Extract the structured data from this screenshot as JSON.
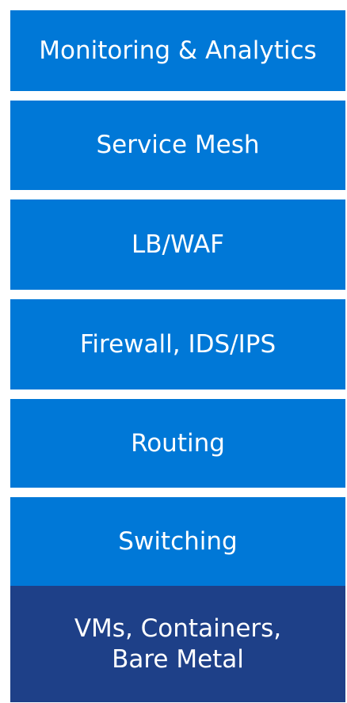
{
  "layers": [
    {
      "label": "Monitoring & Analytics",
      "color": "#0078D7"
    },
    {
      "label": "Service Mesh",
      "color": "#0078D7"
    },
    {
      "label": "LB/WAF",
      "color": "#0078D7"
    },
    {
      "label": "Firewall, IDS/IPS",
      "color": "#0078D7"
    },
    {
      "label": "Routing",
      "color": "#0078D7"
    },
    {
      "label": "Switching",
      "color": "#0078D7"
    },
    {
      "label": "VMs, Containers,\nBare Metal",
      "color": "#1E4088"
    }
  ]
}
